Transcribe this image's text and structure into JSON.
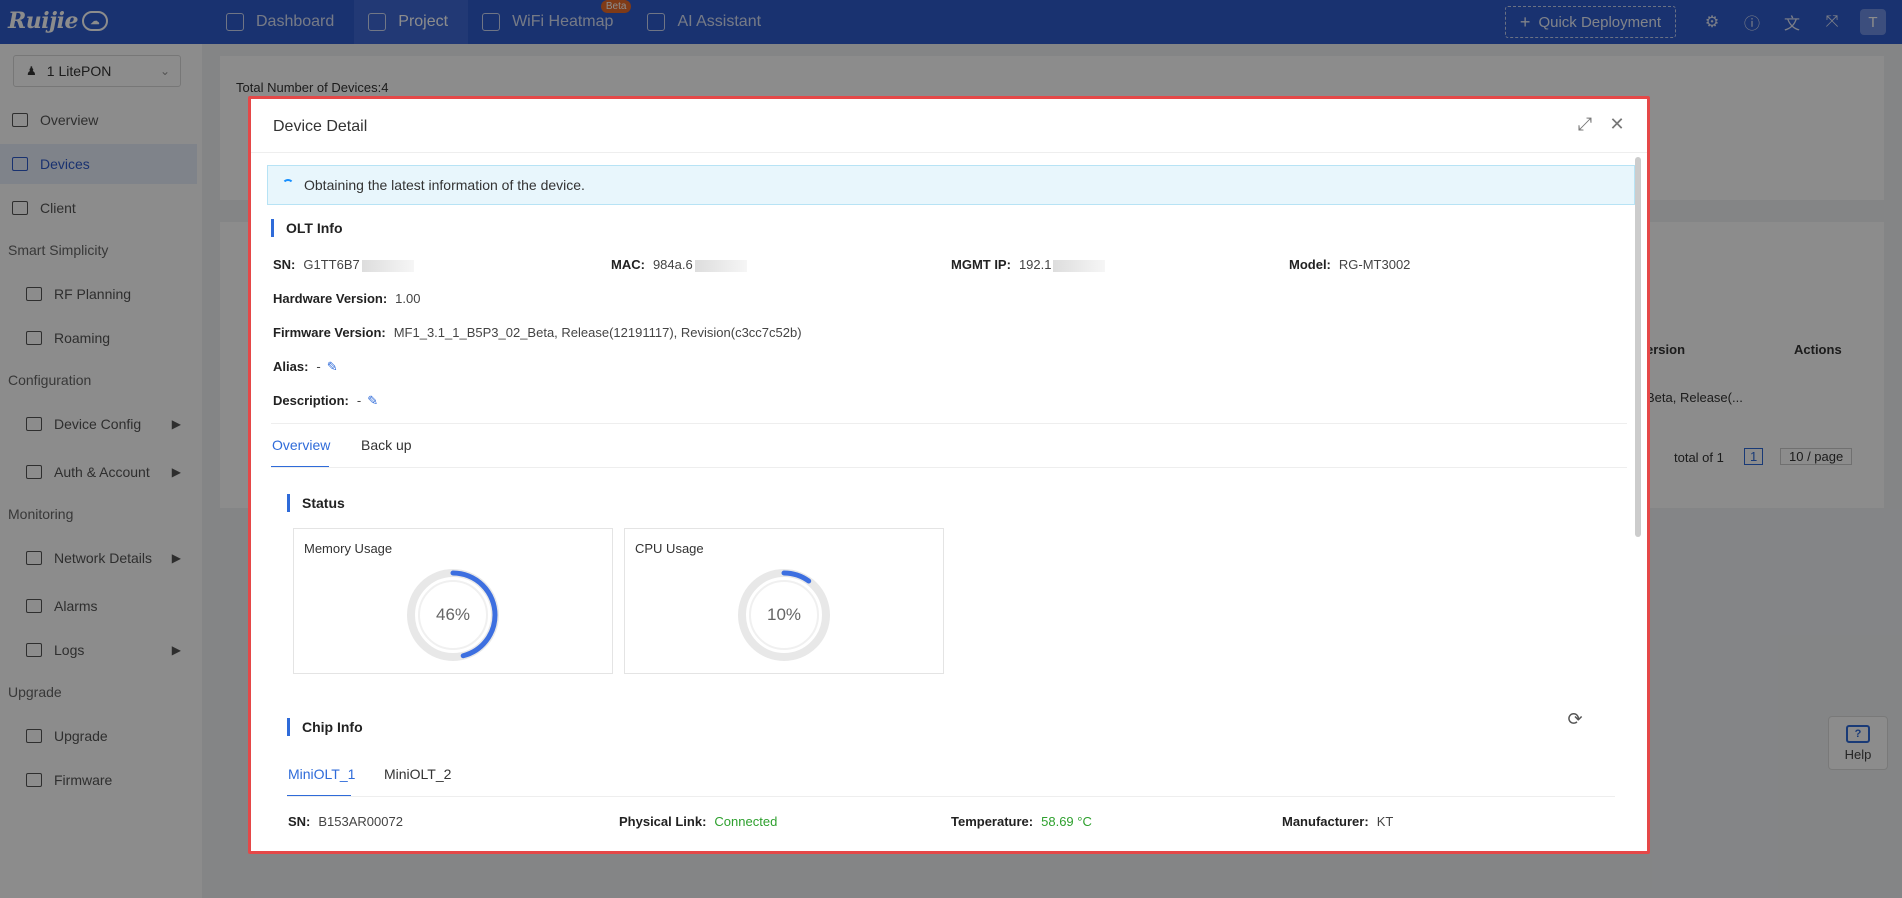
{
  "topbar": {
    "brand": "Ruijie",
    "cloud": "cloud",
    "nav": [
      {
        "label": "Dashboard",
        "icon": "dashboard-icon"
      },
      {
        "label": "Project",
        "icon": "cube-icon"
      },
      {
        "label": "WiFi Heatmap",
        "icon": "heatmap-icon",
        "badge": "Beta"
      },
      {
        "label": "AI Assistant",
        "icon": "grid-icon"
      }
    ],
    "quick_deployment": "Quick Deployment",
    "avatar": "T"
  },
  "sidebar": {
    "project": "1 LitePON",
    "items": [
      {
        "label": "Overview"
      },
      {
        "label": "Devices"
      },
      {
        "label": "Client"
      },
      {
        "label": "RF Planning"
      },
      {
        "label": "Roaming"
      },
      {
        "label": "Device Config"
      },
      {
        "label": "Auth & Account"
      },
      {
        "label": "Network Details"
      },
      {
        "label": "Alarms"
      },
      {
        "label": "Logs"
      },
      {
        "label": "Upgrade"
      },
      {
        "label": "Firmware"
      }
    ],
    "groups": [
      "Smart Simplicity",
      "Configuration",
      "Monitoring",
      "Upgrade"
    ]
  },
  "background": {
    "total_devices": "Total Number of Devices:4",
    "col_version": "ersion",
    "col_actions": "Actions",
    "row_version": "Beta, Release(...",
    "pager_total": "total of 1",
    "pager_page": "1",
    "pager_size": "10 / page"
  },
  "modal": {
    "title": "Device Detail",
    "banner": "Obtaining the latest information of the device.",
    "olt_title": "OLT Info",
    "sn_label": "SN:",
    "sn_value": "G1TT6B7",
    "mac_label": "MAC:",
    "mac_value": "984a.6",
    "mgmt_label": "MGMT IP:",
    "mgmt_value": "192.1",
    "model_label": "Model:",
    "model_value": "RG-MT3002",
    "hw_label": "Hardware Version:",
    "hw_value": "1.00",
    "fw_label": "Firmware Version:",
    "fw_value": "MF1_3.1_1_B5P3_02_Beta, Release(12191117), Revision(c3cc7c52b)",
    "alias_label": "Alias:",
    "alias_value": "-",
    "desc_label": "Description:",
    "desc_value": "-",
    "tabs": [
      "Overview",
      "Back up"
    ],
    "status_title": "Status",
    "memory_title": "Memory Usage",
    "memory_pct": 46,
    "memory_text": "46%",
    "cpu_title": "CPU Usage",
    "cpu_pct": 10,
    "cpu_text": "10%",
    "chip_title": "Chip Info",
    "chip_tabs": [
      "MiniOLT_1",
      "MiniOLT_2"
    ],
    "chip_sn_label": "SN:",
    "chip_sn_value": "B153AR00072",
    "link_label": "Physical Link:",
    "link_value": "Connected",
    "temp_label": "Temperature:",
    "temp_value": "58.69 °C",
    "mfr_label": "Manufacturer:",
    "mfr_value": "KT"
  },
  "help": {
    "label": "Help"
  },
  "colors": {
    "primary": "#2f5bcc",
    "accent": "#2f6bd9",
    "highlight_border": "#e54848",
    "success": "#2ea02e"
  }
}
